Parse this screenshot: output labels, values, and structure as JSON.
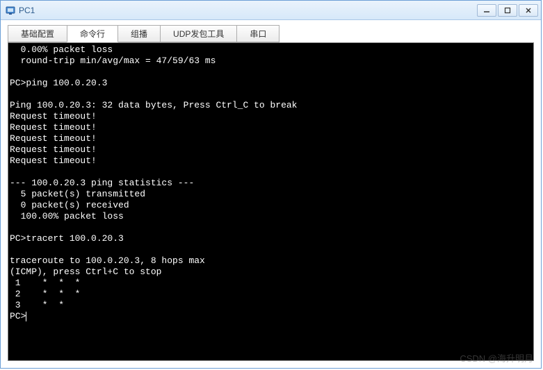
{
  "window": {
    "title": "PC1"
  },
  "tabs": [
    {
      "label": "基础配置",
      "active": false
    },
    {
      "label": "命令行",
      "active": true
    },
    {
      "label": "组播",
      "active": false
    },
    {
      "label": "UDP发包工具",
      "active": false
    },
    {
      "label": "串口",
      "active": false
    }
  ],
  "terminal": {
    "lines": [
      "  0.00% packet loss",
      "  round-trip min/avg/max = 47/59/63 ms",
      "",
      "PC>ping 100.0.20.3",
      "",
      "Ping 100.0.20.3: 32 data bytes, Press Ctrl_C to break",
      "Request timeout!",
      "Request timeout!",
      "Request timeout!",
      "Request timeout!",
      "Request timeout!",
      "",
      "--- 100.0.20.3 ping statistics ---",
      "  5 packet(s) transmitted",
      "  0 packet(s) received",
      "  100.00% packet loss",
      "",
      "PC>tracert 100.0.20.3",
      "",
      "traceroute to 100.0.20.3, 8 hops max",
      "(ICMP), press Ctrl+C to stop",
      " 1    *  *  *",
      " 2    *  *  *",
      " 3    *  *"
    ],
    "prompt": "PC>"
  },
  "watermark": "CSDN @海升明月"
}
